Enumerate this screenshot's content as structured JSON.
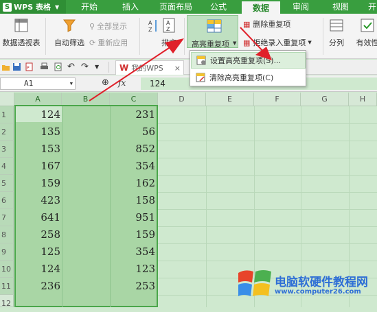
{
  "app": {
    "title": "WPS 表格"
  },
  "tabs": [
    {
      "label": "开始"
    },
    {
      "label": "插入"
    },
    {
      "label": "页面布局"
    },
    {
      "label": "公式"
    },
    {
      "label": "数据"
    },
    {
      "label": "审阅"
    },
    {
      "label": "视图"
    },
    {
      "label": "开"
    }
  ],
  "ribbon": {
    "pivot": "数据透视表",
    "autofilter": "自动筛选",
    "show_all": "全部显示",
    "reapply": "重新应用",
    "sort": "排序",
    "highlight_dup": "高亮重复项",
    "delete_dup": "删除重复项",
    "reject_dup": "拒绝录入重复项",
    "split": "分列",
    "validity": "有效性"
  },
  "dropdown": [
    {
      "label": "设置高亮重复项(S)..."
    },
    {
      "label": "清除高亮重复项(C)"
    }
  ],
  "doc_tab": {
    "label": "我的WPS"
  },
  "formula_bar": {
    "cell_ref": "A1",
    "fx": "fx",
    "value": "124"
  },
  "columns": [
    "A",
    "B",
    "C",
    "D",
    "E",
    "F",
    "G",
    "H"
  ],
  "rows": [
    "1",
    "2",
    "3",
    "4",
    "5",
    "6",
    "7",
    "8",
    "9",
    "10",
    "11",
    "12"
  ],
  "cells": {
    "A": [
      "124",
      "135",
      "153",
      "167",
      "159",
      "423",
      "641",
      "258",
      "125",
      "124",
      "236"
    ],
    "C": [
      "231",
      "56",
      "852",
      "354",
      "162",
      "158",
      "951",
      "159",
      "354",
      "123",
      "253"
    ]
  },
  "watermark": {
    "text": "电脑软硬件教程网",
    "url": "www.computer26.com"
  },
  "colors": {
    "accent": "#399e3f",
    "selection": "#a9d6a5",
    "arrow": "#e0202a"
  }
}
